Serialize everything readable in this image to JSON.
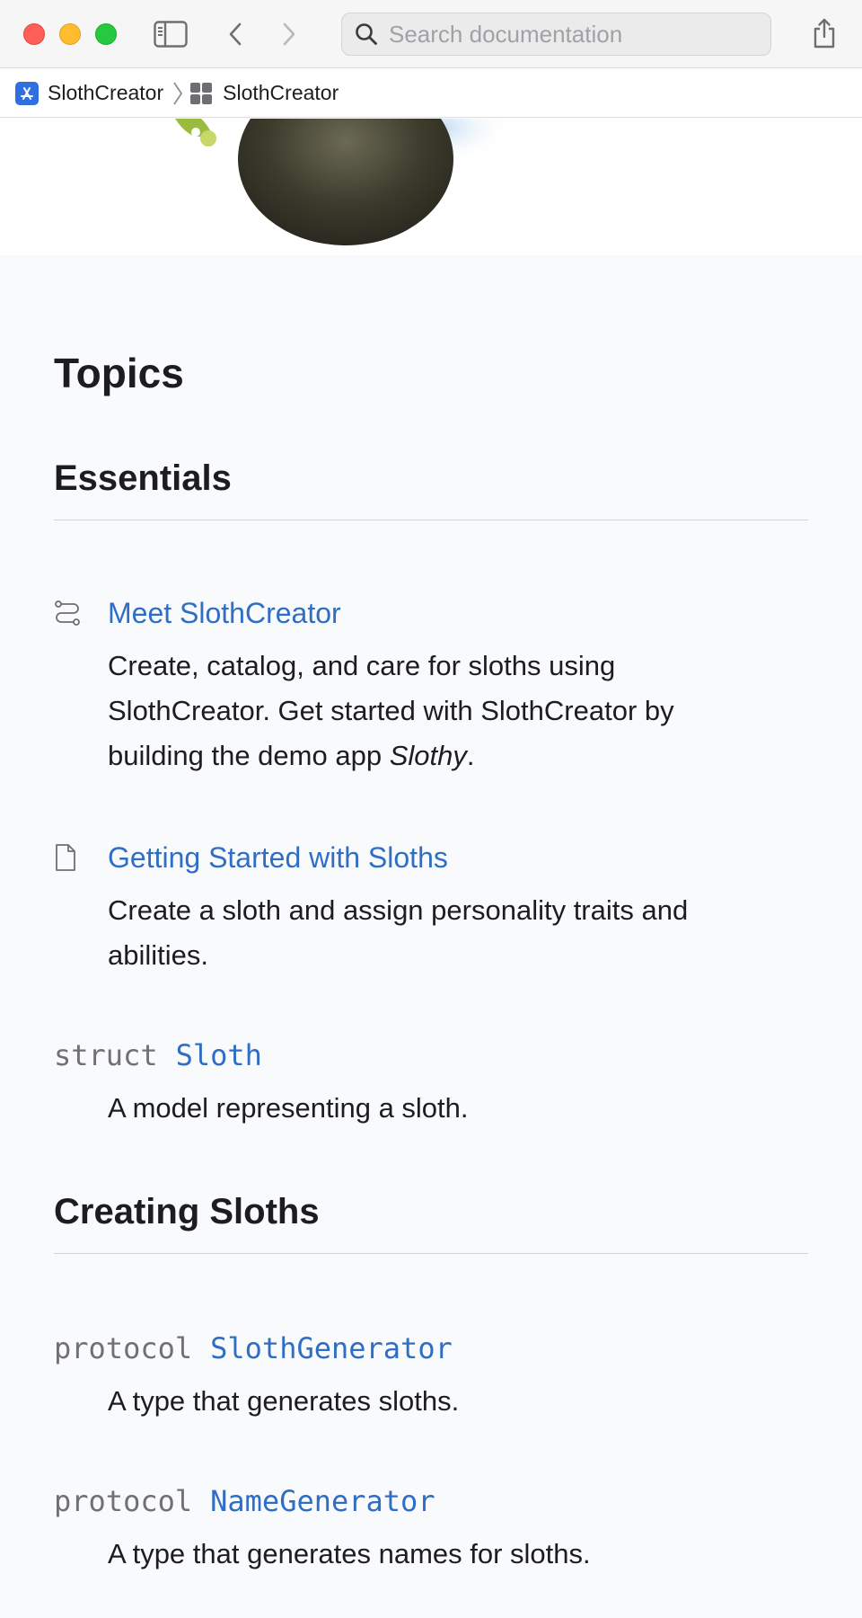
{
  "toolbar": {
    "search_placeholder": "Search documentation"
  },
  "breadcrumb": {
    "items": [
      {
        "label": "SlothCreator"
      },
      {
        "label": "SlothCreator"
      }
    ]
  },
  "topics": {
    "title": "Topics",
    "sections": [
      {
        "title": "Essentials",
        "items": [
          {
            "icon": "tutorial-icon",
            "link": "Meet SlothCreator",
            "desc_prefix": "Create, catalog, and care for sloths using SlothCreator. Get started with SlothCreator by building the demo app ",
            "desc_emphasis": "Slothy",
            "desc_suffix": "."
          },
          {
            "icon": "article-icon",
            "link": "Getting Started with Sloths",
            "desc": "Create a sloth and assign personality traits and abilities."
          },
          {
            "keyword": "struct",
            "symbol": "Sloth",
            "desc": "A model representing a sloth."
          }
        ]
      },
      {
        "title": "Creating Sloths",
        "items": [
          {
            "keyword": "protocol",
            "symbol": "SlothGenerator",
            "desc": "A type that generates sloths."
          },
          {
            "keyword": "protocol",
            "symbol": "NameGenerator",
            "desc": "A type that generates names for sloths."
          }
        ]
      }
    ]
  },
  "colors": {
    "link": "#2f6ec4",
    "keyword": "#707075",
    "background": "#f9fafc"
  }
}
